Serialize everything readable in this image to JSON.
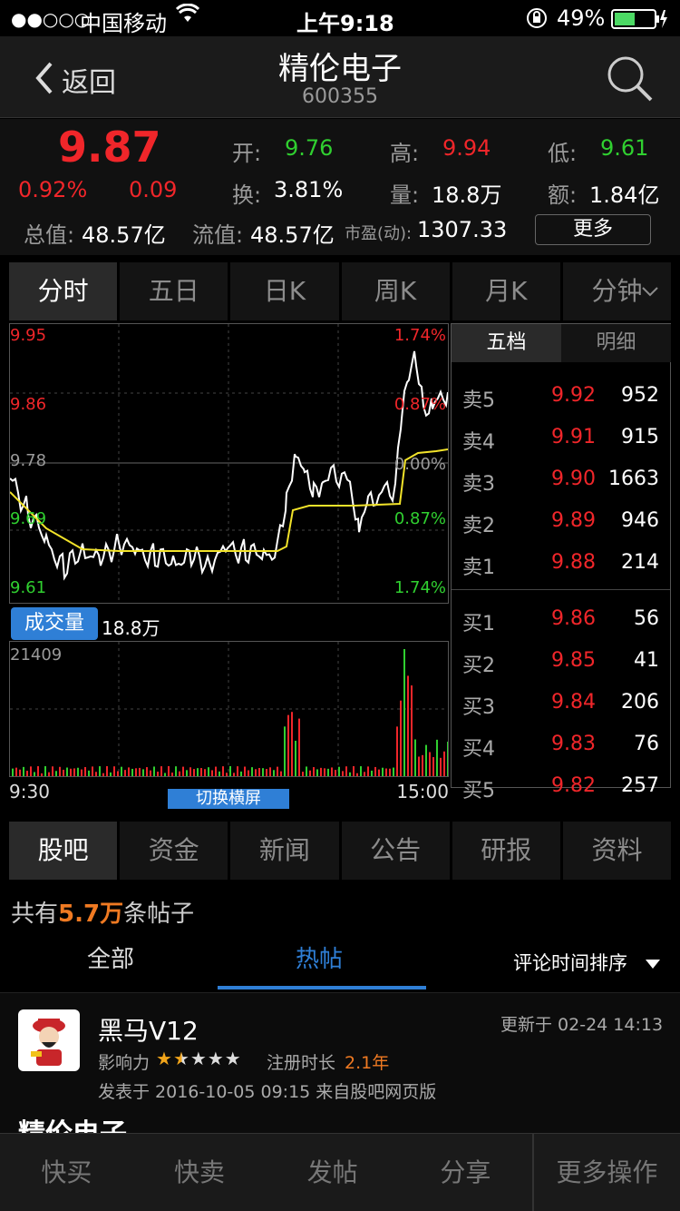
{
  "status": {
    "signal": "●●○○○",
    "carrier": "中国移动",
    "time": "上午9:18",
    "battery": "49%"
  },
  "header": {
    "back": "返回",
    "title": "精伦电子",
    "code": "600355"
  },
  "quote": {
    "price": "9.87",
    "pct": "0.92%",
    "chg": "0.09",
    "open_l": "开:",
    "open": "9.76",
    "high_l": "高:",
    "high": "9.94",
    "low_l": "低:",
    "low": "9.61",
    "turn_l": "换:",
    "turn": "3.81%",
    "vol_l": "量:",
    "vol": "18.8万",
    "amt_l": "额:",
    "amt": "1.84亿",
    "mcap_l": "总值:",
    "mcap": "48.57亿",
    "float_l": "流值:",
    "float": "48.57亿",
    "pe_l": "市盈(动):",
    "pe": "1307.33",
    "more": "更多"
  },
  "period_tabs": [
    "分时",
    "五日",
    "日K",
    "周K",
    "月K",
    "分钟"
  ],
  "intraday": {
    "price_labels": [
      "9.95",
      "9.86",
      "9.78",
      "9.69",
      "9.61"
    ],
    "pct_labels": [
      "1.74%",
      "0.87%",
      "0.00%",
      "0.87%",
      "1.74%"
    ],
    "volume_btn": "成交量",
    "volume_total": "18.8万",
    "vol_max": "21409",
    "time_start": "9:30",
    "time_end": "15:00",
    "landscape": "切换横屏"
  },
  "depth": {
    "tabs": [
      "五档",
      "明细"
    ],
    "sell": [
      {
        "label": "卖5",
        "price": "9.92",
        "qty": "952"
      },
      {
        "label": "卖4",
        "price": "9.91",
        "qty": "915"
      },
      {
        "label": "卖3",
        "price": "9.90",
        "qty": "1663"
      },
      {
        "label": "卖2",
        "price": "9.89",
        "qty": "946"
      },
      {
        "label": "卖1",
        "price": "9.88",
        "qty": "214"
      }
    ],
    "buy": [
      {
        "label": "买1",
        "price": "9.86",
        "qty": "56"
      },
      {
        "label": "买2",
        "price": "9.85",
        "qty": "41"
      },
      {
        "label": "买3",
        "price": "9.84",
        "qty": "206"
      },
      {
        "label": "买4",
        "price": "9.83",
        "qty": "76"
      },
      {
        "label": "买5",
        "price": "9.82",
        "qty": "257"
      }
    ]
  },
  "info_tabs": [
    "股吧",
    "资金",
    "新闻",
    "公告",
    "研报",
    "资料"
  ],
  "forum": {
    "count_pre": "共有",
    "count": "5.7万",
    "count_post": "条帖子",
    "sub_tabs": [
      "全部",
      "热帖"
    ],
    "sort": "评论时间排序"
  },
  "post": {
    "author": "黑马V12",
    "updated": "更新于 02-24 14:13",
    "influence_l": "影响力",
    "stars": "★★★★★",
    "reg_l": "注册时长",
    "reg": "2.1年",
    "posted": "发表于 2016-10-05 09:15  来自股吧网页版",
    "title": "精伦电子"
  },
  "bottom": [
    "快买",
    "快卖",
    "发帖",
    "分享",
    "更多操作"
  ],
  "colors": {
    "up": "#f0262a",
    "down": "#30d030",
    "avg": "#f2e32a",
    "accent": "#2f7fd6",
    "orange": "#f07a22"
  }
}
